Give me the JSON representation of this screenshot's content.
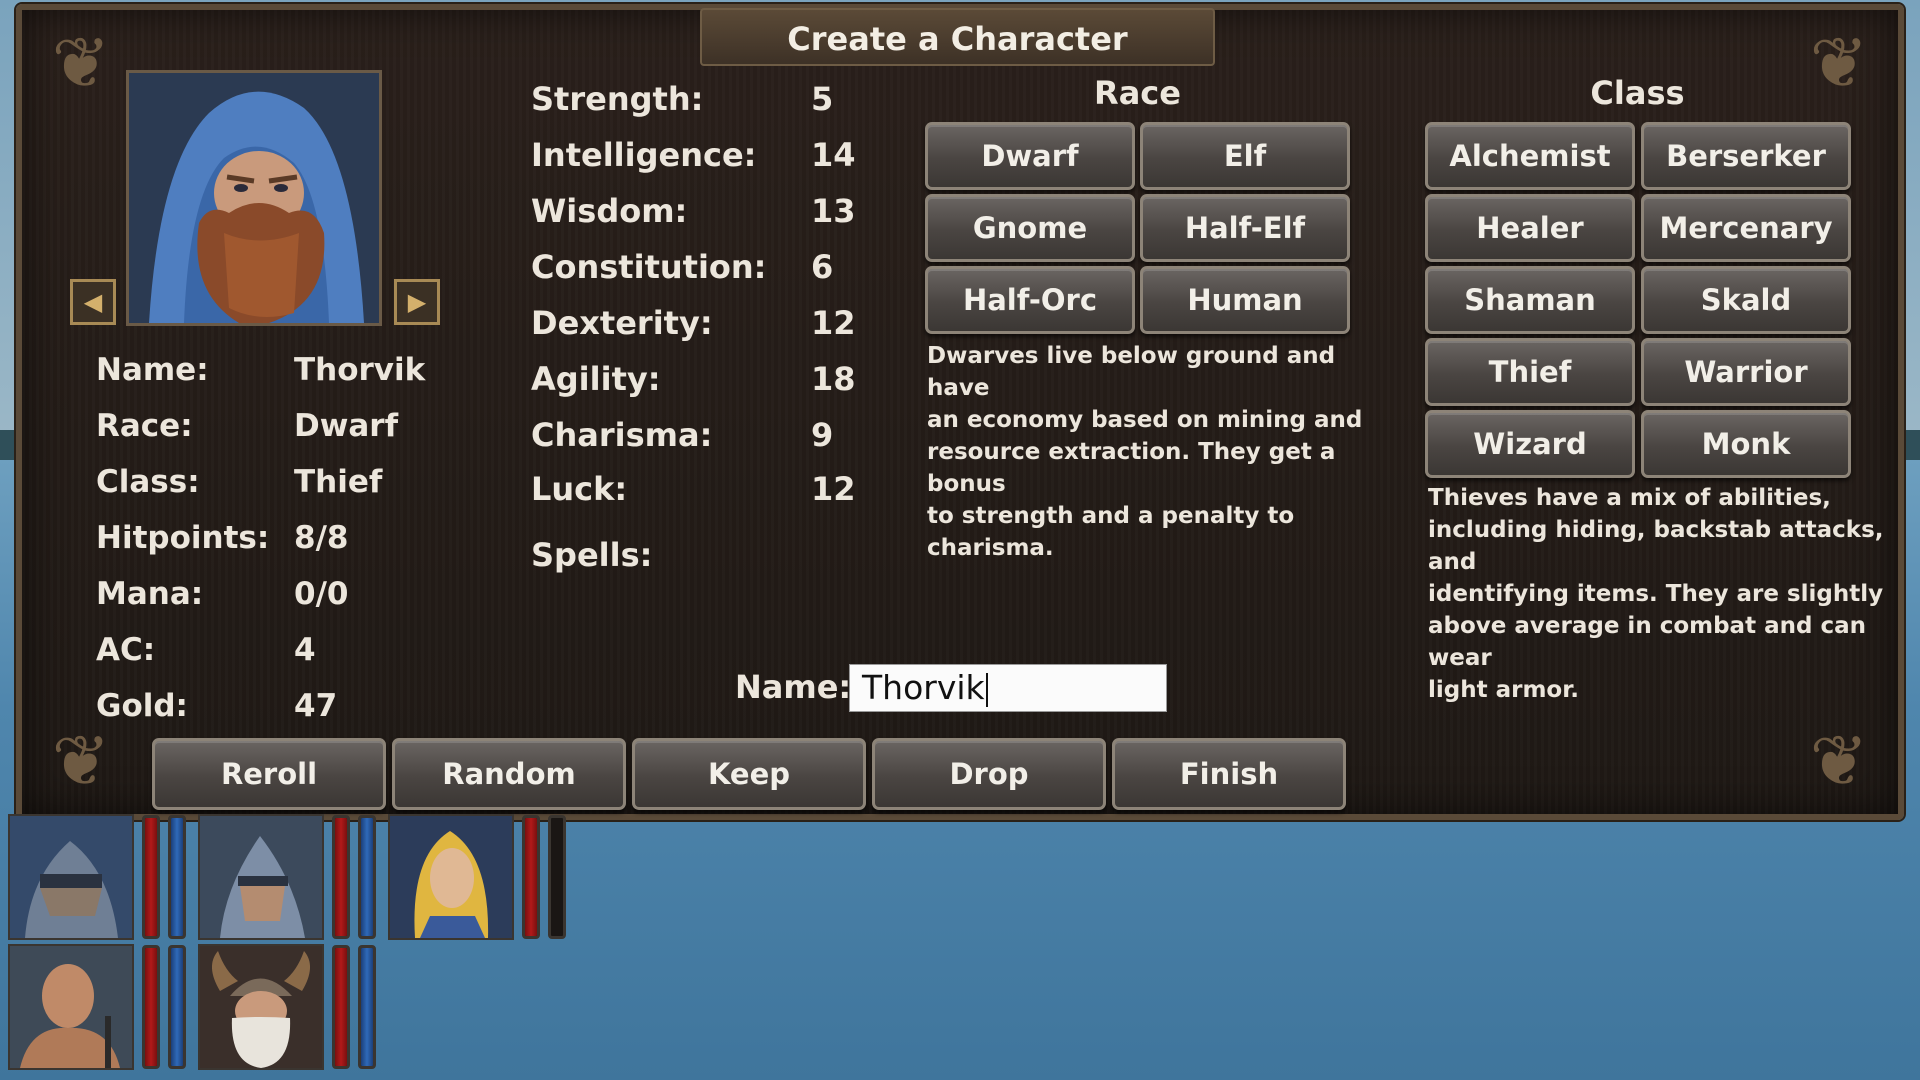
{
  "title": "Create a Character",
  "summary": {
    "rows": [
      {
        "label": "Name:",
        "value": "Thorvik"
      },
      {
        "label": "Race:",
        "value": "Dwarf"
      },
      {
        "label": "Class:",
        "value": "Thief"
      },
      {
        "label": "Hitpoints:",
        "value": "8/8"
      },
      {
        "label": "Mana:",
        "value": "0/0"
      },
      {
        "label": "AC:",
        "value": "4"
      },
      {
        "label": "Gold:",
        "value": "47"
      }
    ]
  },
  "stats": [
    {
      "label": "Strength:",
      "value": "5"
    },
    {
      "label": "Intelligence:",
      "value": "14"
    },
    {
      "label": "Wisdom:",
      "value": "13"
    },
    {
      "label": "Constitution:",
      "value": "6"
    },
    {
      "label": "Dexterity:",
      "value": "12"
    },
    {
      "label": "Agility:",
      "value": "18"
    },
    {
      "label": "Charisma:",
      "value": "9"
    },
    {
      "label": "Luck:",
      "value": "12"
    }
  ],
  "spells_label": "Spells:",
  "race": {
    "heading": "Race",
    "options": [
      "Dwarf",
      "Elf",
      "Gnome",
      "Half-Elf",
      "Half-Orc",
      "Human"
    ],
    "selected": "Dwarf",
    "description": [
      "Dwarves live below ground and have",
      "an economy based on mining and",
      "resource extraction. They get a bonus",
      "to strength and a penalty to charisma."
    ]
  },
  "class": {
    "heading": "Class",
    "options": [
      "Alchemist",
      "Berserker",
      "Healer",
      "Mercenary",
      "Shaman",
      "Skald",
      "Thief",
      "Warrior",
      "Wizard",
      "Monk"
    ],
    "selected": "Thief",
    "description": [
      "Thieves have a mix of abilities,",
      "including hiding, backstab attacks, and",
      "identifying items. They are slightly",
      "above average in combat and can wear",
      "light armor."
    ]
  },
  "name_field": {
    "label": "Name:",
    "value": "Thorvik"
  },
  "actions": [
    "Reroll",
    "Random",
    "Keep",
    "Drop",
    "Finish"
  ],
  "party": [
    {
      "portrait": "knight-icon",
      "hp": 1.0,
      "mp": 1.0
    },
    {
      "portrait": "helmed-soldier-icon",
      "hp": 1.0,
      "mp": 1.0
    },
    {
      "portrait": "blonde-elf-icon",
      "hp": 1.0,
      "mp": 0.0
    },
    {
      "portrait": "bald-fighter-icon",
      "hp": 1.0,
      "mp": 1.0
    },
    {
      "portrait": "horned-dwarf-icon",
      "hp": 1.0,
      "mp": 1.0
    }
  ],
  "colors": {
    "hp": "#b01a1a",
    "mp": "#2f6ab8",
    "panel": "#231c17",
    "button": "#4a4542"
  }
}
